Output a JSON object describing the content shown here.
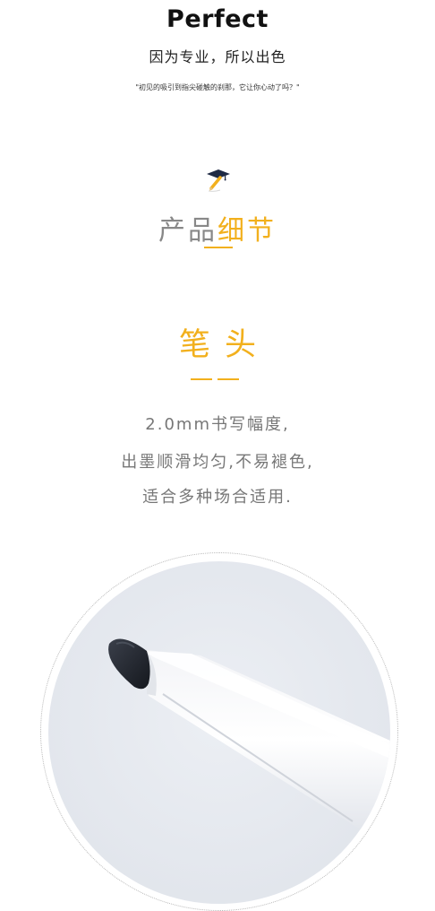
{
  "header": {
    "title": "Perfect",
    "subtitle": "因为专业，所以出色",
    "quote": "\"初见的吸引到指尖碰触的刹那，它让你心动了吗？\""
  },
  "section": {
    "title_part1": "产品",
    "title_part2": "细节",
    "icon": "graduate-pen-icon"
  },
  "feature": {
    "title": "笔头",
    "description": [
      "2.0mm书写幅度,",
      "出墨顺滑均匀,不易褪色,",
      "适合多种场合适用."
    ]
  },
  "product_image": {
    "subject": "marker-pen-tip-photo"
  },
  "colors": {
    "accent": "#f2b01d",
    "heading_gray": "#888888",
    "text_gray": "#777777"
  }
}
